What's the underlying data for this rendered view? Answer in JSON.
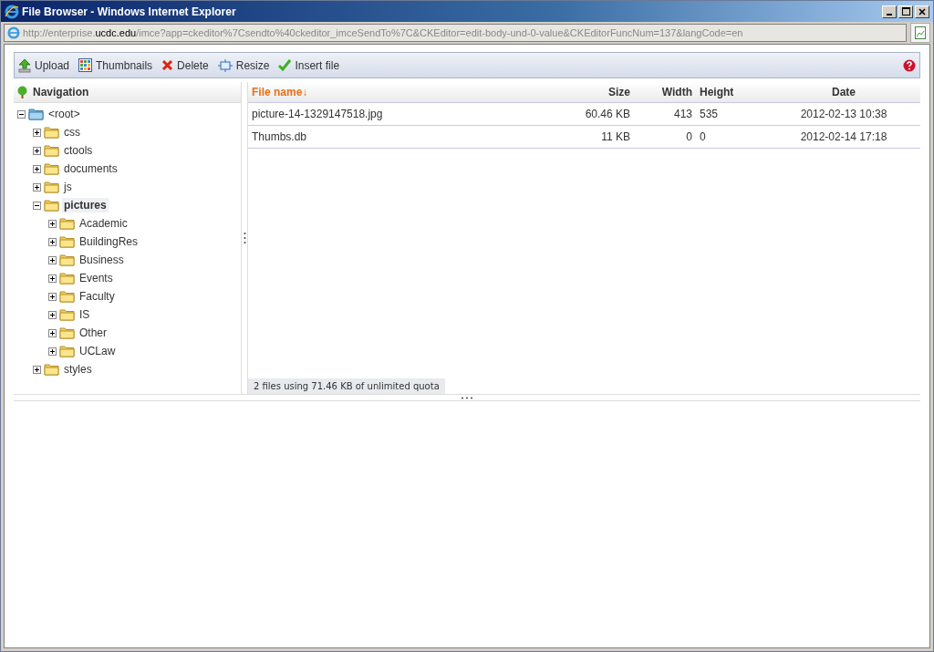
{
  "window": {
    "title": "File Browser - Windows Internet Explorer"
  },
  "address": {
    "prefix": "http://enterprise.",
    "host": "ucdc.edu",
    "path": "/imce?app=ckeditor%7Csendto%40ckeditor_imceSendTo%7C&CKEditor=edit-body-und-0-value&CKEditorFuncNum=137&langCode=en"
  },
  "toolbar": [
    {
      "kind": "upload",
      "label": "Upload"
    },
    {
      "kind": "thumbnails",
      "label": "Thumbnails"
    },
    {
      "kind": "delete",
      "label": "Delete"
    },
    {
      "kind": "resize",
      "label": "Resize"
    },
    {
      "kind": "insert",
      "label": "Insert file"
    }
  ],
  "navigation": {
    "title": "Navigation",
    "tree": [
      {
        "label": "<root>",
        "kind": "root",
        "expanded": true,
        "selected": false,
        "children": [
          {
            "label": "css",
            "expanded": false,
            "selected": false
          },
          {
            "label": "ctools",
            "expanded": false,
            "selected": false
          },
          {
            "label": "documents",
            "expanded": false,
            "selected": false
          },
          {
            "label": "js",
            "expanded": false,
            "selected": false
          },
          {
            "label": "pictures",
            "expanded": true,
            "selected": true,
            "children": [
              {
                "label": "Academic",
                "expanded": false,
                "selected": false
              },
              {
                "label": "BuildingRes",
                "expanded": false,
                "selected": false
              },
              {
                "label": "Business",
                "expanded": false,
                "selected": false
              },
              {
                "label": "Events",
                "expanded": false,
                "selected": false
              },
              {
                "label": "Faculty",
                "expanded": false,
                "selected": false
              },
              {
                "label": "IS",
                "expanded": false,
                "selected": false
              },
              {
                "label": "Other",
                "expanded": false,
                "selected": false
              },
              {
                "label": "UCLaw",
                "expanded": false,
                "selected": false
              }
            ]
          },
          {
            "label": "styles",
            "expanded": false,
            "selected": false
          }
        ]
      }
    ]
  },
  "table": {
    "columns": [
      {
        "label": "File name",
        "sorted": true,
        "sort_arrow": "↓"
      },
      {
        "label": "Size",
        "sorted": false
      },
      {
        "label": "Width",
        "sorted": false
      },
      {
        "label": "Height",
        "sorted": false
      },
      {
        "label": "Date",
        "sorted": false
      }
    ],
    "rows": [
      {
        "cells": [
          "picture-14-1329147518.jpg",
          "60.46 KB",
          "413",
          "535",
          "2012-02-13 10:38"
        ]
      },
      {
        "cells": [
          "Thumbs.db",
          "11 KB",
          "0",
          "0",
          "2012-02-14 17:18"
        ]
      }
    ]
  },
  "status_bar": "2 files using 71.46 KB of unlimited quota"
}
